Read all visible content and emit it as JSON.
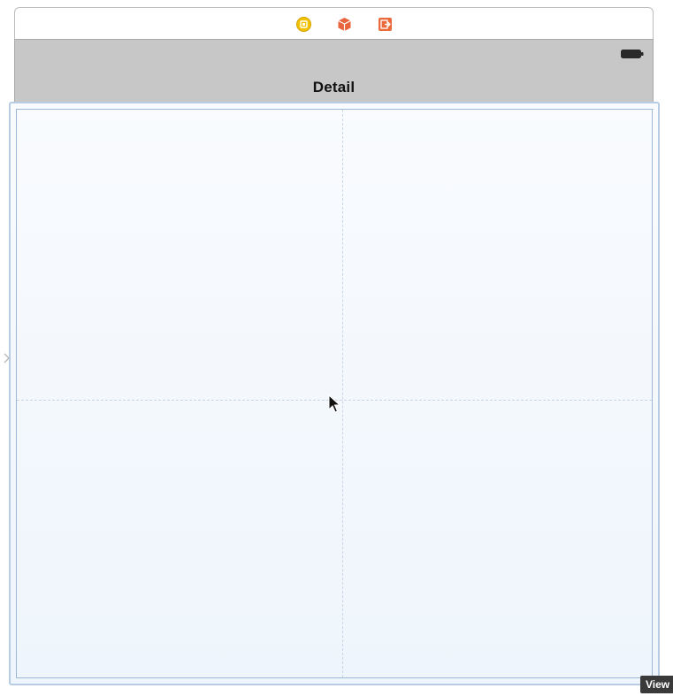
{
  "scene_dock": {
    "icons": [
      {
        "name": "view-controller-icon",
        "color": "#e8b400"
      },
      {
        "name": "first-responder-icon",
        "color": "#e8643c"
      },
      {
        "name": "exit-icon",
        "color": "#ea6a3b"
      }
    ]
  },
  "nav_bar": {
    "title": "Detail",
    "background": "#c7c7c7",
    "battery": "battery-icon"
  },
  "canvas": {
    "background": "#eef5fc",
    "selection_color": "#b8cde4"
  },
  "tooltip": {
    "label": "View"
  },
  "cursor": "arrow-cursor-icon"
}
